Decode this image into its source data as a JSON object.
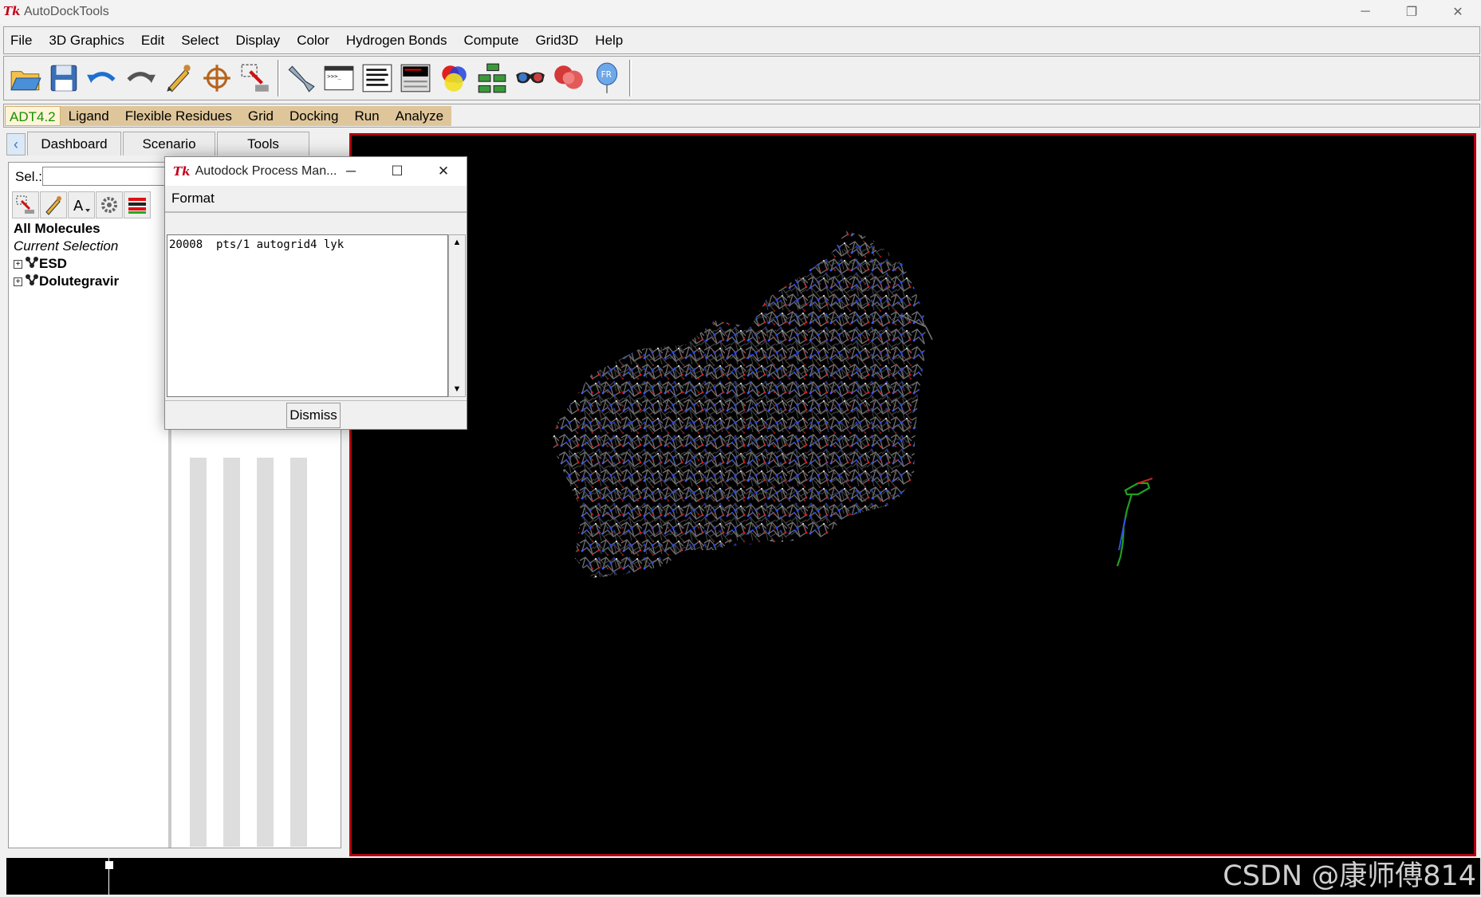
{
  "window": {
    "title": "AutoDockTools",
    "minimize": "─",
    "restore": "❐",
    "close": "✕",
    "app_icon": "Tk"
  },
  "menubar": [
    "File",
    "3D Graphics",
    "Edit",
    "Select",
    "Display",
    "Color",
    "Hydrogen Bonds",
    "Compute",
    "Grid3D",
    "Help"
  ],
  "toolbar_icons": [
    "open-folder-icon",
    "save-icon",
    "undo-icon",
    "redo-icon",
    "pencil-icon",
    "crosshair-icon",
    "select-icon",
    "hand-icon",
    "python-shell-icon",
    "text-lines-icon",
    "console-icon",
    "color-sphere-icon",
    "tree-icon",
    "glasses-icon",
    "molecule-surface-icon",
    "balloon-icon"
  ],
  "adt_tabs": [
    "ADT4.2",
    "Ligand",
    "Flexible Residues",
    "Grid",
    "Docking",
    "Run",
    "Analyze"
  ],
  "dashboard": {
    "tabs": [
      "Dashboard",
      "Scenario",
      "Tools"
    ],
    "sel_label": "Sel.:",
    "sel_value": "",
    "all_molecules": "All Molecules",
    "current_selection": "Current Selection",
    "molecules": [
      "ESD",
      "Dolutegravir"
    ]
  },
  "dialog": {
    "title": "Autodock Process Man...",
    "menu": "Format",
    "process_line": "20008  pts/1 autogrid4 lyk",
    "dismiss": "Dismiss"
  },
  "watermark": "CSDN @康师傅814",
  "colors": {
    "viewer_bg": "#000000",
    "viewer_border": "#b00010",
    "adt_tab_bg": "#dfc69a",
    "adt_active": "#1a8f00"
  }
}
